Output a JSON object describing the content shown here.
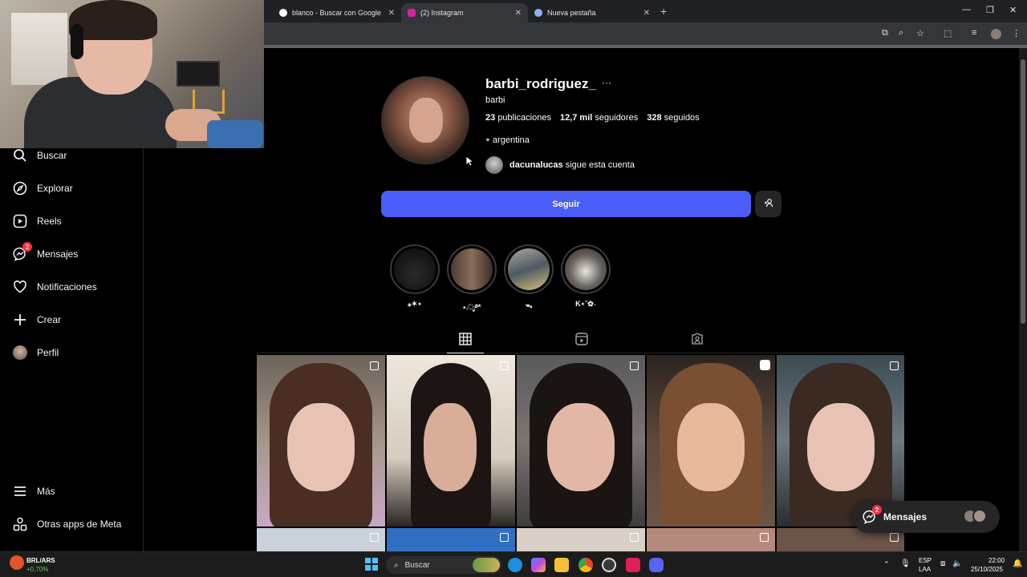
{
  "browser": {
    "tabs": [
      {
        "label": "blanco - Buscar con Google",
        "active": false
      },
      {
        "label": "(2) Instagram",
        "active": true
      },
      {
        "label": "Nueva pestaña",
        "active": false
      }
    ]
  },
  "sidebar": {
    "items": [
      {
        "label": "Buscar",
        "icon": "search-icon"
      },
      {
        "label": "Explorar",
        "icon": "compass-icon"
      },
      {
        "label": "Reels",
        "icon": "reels-icon"
      },
      {
        "label": "Mensajes",
        "icon": "messenger-icon",
        "badge": "2"
      },
      {
        "label": "Notificaciones",
        "icon": "heart-icon"
      },
      {
        "label": "Crear",
        "icon": "plus-icon"
      },
      {
        "label": "Perfil",
        "icon": "avatar"
      }
    ],
    "bottom": [
      {
        "label": "Más",
        "icon": "menu-icon"
      },
      {
        "label": "Otras apps de Meta",
        "icon": "meta-apps-icon"
      }
    ]
  },
  "profile": {
    "username": "barbi_rodriguez_",
    "more": "···",
    "full_name": "barbi",
    "posts_count": "23",
    "posts_label": "publicaciones",
    "followers_count": "12,7 mil",
    "followers_label": "seguidores",
    "following_count": "328",
    "following_label": "seguidos",
    "bio": "⭒ argentina",
    "followed_by_user": "dacunalucas",
    "followed_by_text": "sigue esta cuenta",
    "follow_label": "Seguir"
  },
  "highlights": [
    {
      "label": "⁎✶⋆"
    },
    {
      "label": "⋆.ೃ࿔*"
    },
    {
      "label": "ᯓ"
    },
    {
      "label": "K⋆˚✿˖"
    }
  ],
  "messages_pill": {
    "label": "Mensajes",
    "badge": "2"
  },
  "taskbar": {
    "widget_title": "BRL/ARS",
    "widget_change": "+0,70%",
    "search_placeholder": "Buscar",
    "lang": "ESP",
    "lang2": "LAA",
    "time": "22:00",
    "date": "25/10/2025"
  },
  "colors": {
    "follow_button": "#4a5df9",
    "badge": "#ff3040",
    "background": "#000000"
  }
}
